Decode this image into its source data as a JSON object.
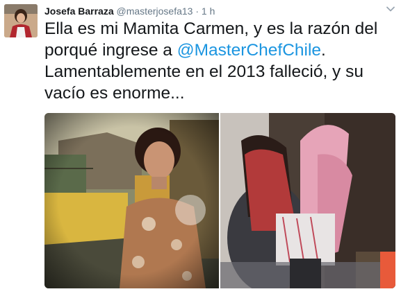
{
  "tweet": {
    "display_name": "Josefa Barraza",
    "handle": "@masterjosefa13",
    "separator": "·",
    "timestamp": "1 h",
    "text_part1": "Ella es mi Mamita Carmen, y es la razón del porqué ingrese a ",
    "mention": "@MasterChefChile",
    "text_part2": ". Lamentablemente en el 2013 falleció, y su vacío es enorme...",
    "icons": [
      "avatar",
      "chevron-down-icon"
    ],
    "colors": {
      "link": "#1b95e0",
      "secondary": "#657786",
      "text": "#14171a"
    }
  }
}
